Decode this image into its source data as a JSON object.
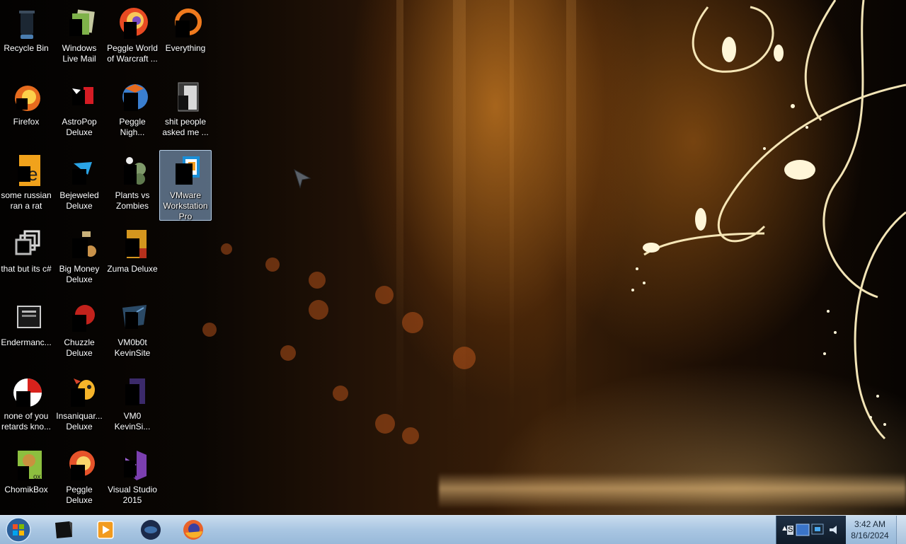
{
  "desktop": {
    "icons": [
      {
        "label": "Recycle Bin",
        "icon": "recycle-bin-icon"
      },
      {
        "label": "Windows Live Mail",
        "icon": "windows-live-mail-icon"
      },
      {
        "label": "Peggle World of Warcraft ...",
        "icon": "peggle-world-of-warcraft-icon"
      },
      {
        "label": "Everything",
        "icon": "everything-search-icon"
      },
      {
        "label": "Firefox",
        "icon": "firefox-icon"
      },
      {
        "label": "AstroPop Deluxe",
        "icon": "astropop-deluxe-icon"
      },
      {
        "label": "Peggle Nigh...",
        "icon": "peggle-nights-icon"
      },
      {
        "label": "shit people asked me ...",
        "icon": "folder-icon"
      },
      {
        "label": "some russian ran a rat",
        "icon": "text-document-icon"
      },
      {
        "label": "Bejeweled Deluxe",
        "icon": "bejeweled-deluxe-icon"
      },
      {
        "label": "Plants vs Zombies",
        "icon": "plants-vs-zombies-icon"
      },
      {
        "label": "VMware Workstation Pro",
        "icon": "vmware-workstation-icon",
        "selected": true
      },
      {
        "label": "that but its c#",
        "icon": "folder-stack-icon"
      },
      {
        "label": "Big Money Deluxe",
        "icon": "big-money-deluxe-icon"
      },
      {
        "label": "Zuma Deluxe",
        "icon": "zuma-deluxe-icon"
      },
      {
        "label": "Endermanc...",
        "icon": "program-window-icon"
      },
      {
        "label": "Chuzzle Deluxe",
        "icon": "chuzzle-deluxe-icon"
      },
      {
        "label": "VM0b0t KevinSite",
        "icon": "vm0b0t-kevinsite-icon"
      },
      {
        "label": "none of you retards kno...",
        "icon": "pie-chart-icon"
      },
      {
        "label": "Insaniquar... Deluxe",
        "icon": "insaniquarium-deluxe-icon"
      },
      {
        "label": "VM0 KevinSi...",
        "icon": "vm0-kevinsite-icon"
      },
      {
        "label": "ChomikBox",
        "icon": "chomikbox-icon"
      },
      {
        "label": "Peggle Deluxe",
        "icon": "peggle-deluxe-icon"
      },
      {
        "label": "Visual Studio 2015",
        "icon": "visual-studio-icon"
      }
    ]
  },
  "taskbar": {
    "start_icon": "windows-start-orb-icon",
    "pinned": [
      {
        "icon": "computer-case-icon"
      },
      {
        "icon": "media-player-icon"
      },
      {
        "icon": "globe-browser-icon"
      },
      {
        "icon": "firefox-icon"
      }
    ],
    "tray_chevron": "▲",
    "tray_letter": "S",
    "clock": {
      "time": "3:42 AM",
      "date": "8/16/2024"
    }
  },
  "colors": {
    "taskbar": "#a9c6e2",
    "selection": "#96b9e1",
    "wallpaper_accent": "#e8a53a"
  }
}
